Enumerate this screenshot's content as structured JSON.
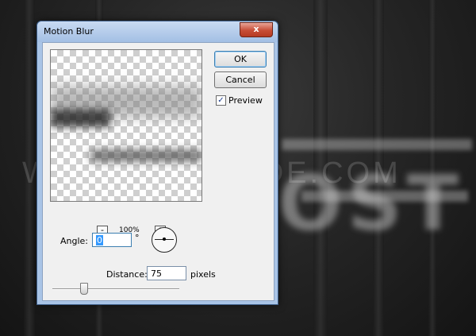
{
  "dialog": {
    "title": "Motion Blur",
    "close_label": "x"
  },
  "preview": {
    "zoom_out_label": "-",
    "zoom_in_label": "+",
    "zoom": "100%"
  },
  "buttons": {
    "ok_label": "OK",
    "cancel_label": "Cancel"
  },
  "preview_toggle": {
    "label": "Preview",
    "checked": true,
    "mark": "✓"
  },
  "angle": {
    "label": "Angle:",
    "value": "0",
    "unit": "°"
  },
  "distance": {
    "label": "Distance:",
    "value": "75",
    "unit": "pixels",
    "slider_fraction": 0.25
  },
  "background": {
    "watermark": "WWW.PSD-DUDE.COM",
    "ghost_text": "OST"
  },
  "icons": [
    "close-icon",
    "zoom-out-icon",
    "zoom-in-icon",
    "checkbox-icon",
    "angle-dial-icon"
  ]
}
